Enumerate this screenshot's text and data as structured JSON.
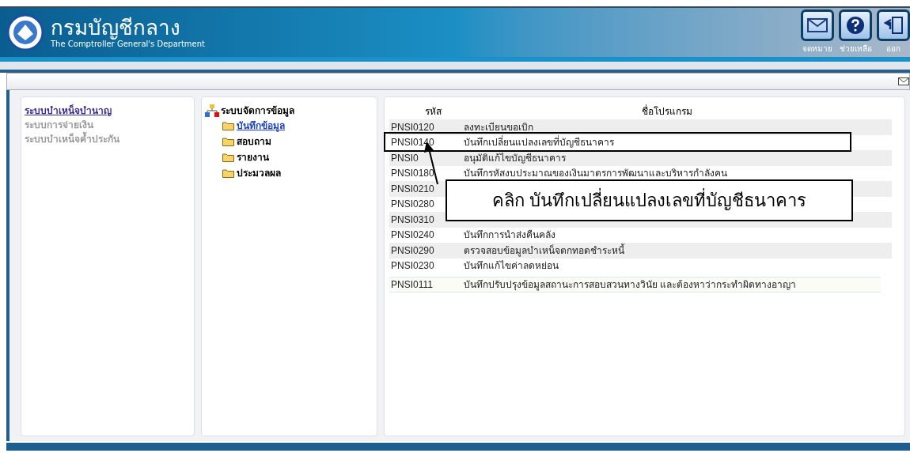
{
  "header": {
    "title": "กรมบัญชีกลาง",
    "subtitle": "The Comptroller General's Department",
    "actions": [
      {
        "kind": "mail",
        "label": "จดหมาย"
      },
      {
        "kind": "help",
        "label": "ช่วยเหลือ"
      },
      {
        "kind": "exit",
        "label": "ออก"
      }
    ]
  },
  "systems": [
    {
      "label": "ระบบบำเหน็จบำนาญ",
      "selected": true
    },
    {
      "label": "ระบบการจ่ายเงิน",
      "selected": false
    },
    {
      "label": "ระบบบำเหน็จค้ำประกัน",
      "selected": false
    }
  ],
  "menu_tree": {
    "label": "ระบบจัดการข้อมูล",
    "children": [
      {
        "label": "บันทึกข้อมูล",
        "selected": true
      },
      {
        "label": "สอบถาม",
        "selected": false
      },
      {
        "label": "รายงาน",
        "selected": false
      },
      {
        "label": "ประมวลผล",
        "selected": false
      }
    ]
  },
  "table": {
    "columns": [
      "รหัส",
      "ชื่อโปรแกรม"
    ],
    "rows": [
      {
        "code": "PNSI0120",
        "name": "ลงทะเบียนขอเบิก"
      },
      {
        "code": "PNSI0140",
        "name": "บันทึกเปลี่ยนแปลงเลขที่บัญชีธนาคาร"
      },
      {
        "code": "PNSI0",
        "name": "อนุมัติแก้ไขบัญชีธนาคาร"
      },
      {
        "code": "PNSI0180",
        "name": "บันทึกรหัสงบประมาณของเงินมาตรการพัฒนาและบริหารกำลังคน"
      },
      {
        "code": "PNSI0210",
        "name": ""
      },
      {
        "code": "PNSI0280",
        "name": ""
      },
      {
        "code": "PNSI0310",
        "name": ""
      },
      {
        "code": "PNSI0240",
        "name": "บันทึกการนำส่งคืนคลัง"
      },
      {
        "code": "PNSI0290",
        "name": "ตรวจสอบข้อมูลบำเหน็จตกทอดชำระหนี้"
      },
      {
        "code": "PNSI0230",
        "name": "บันทึกแก้ไขค่าลดหย่อน"
      },
      {
        "code": "PNSI0111",
        "name": "บันทึกปรับปรุงข้อมูลสถานะการสอบสวนทางวินัย และต้องหาว่ากระทำผิดทางอาญา"
      }
    ]
  },
  "annotation": {
    "text": "คลิก บันทึกเปลี่ยนแปลงเลขที่บัญชีธนาคาร"
  }
}
